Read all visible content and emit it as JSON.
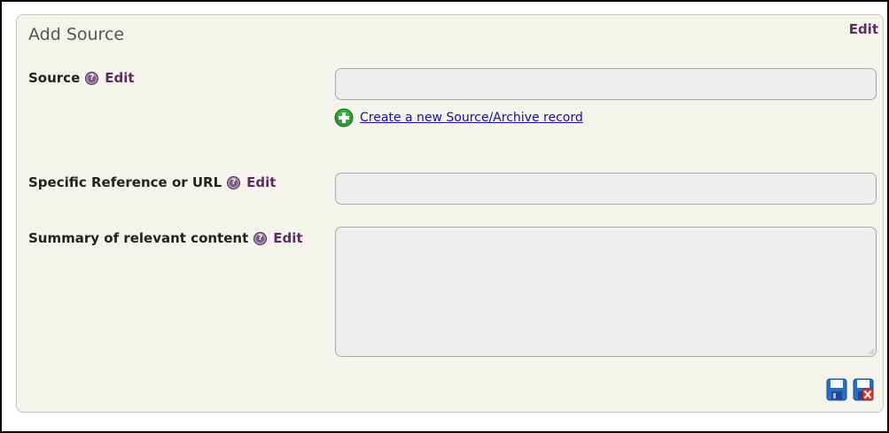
{
  "panel": {
    "title": "Add Source",
    "edit_label": "Edit"
  },
  "fields": {
    "source": {
      "label": "Source",
      "edit_label": "Edit",
      "value": "",
      "create_link": "Create a new Source/Archive record"
    },
    "reference": {
      "label": "Specific Reference or URL",
      "edit_label": "Edit",
      "value": ""
    },
    "summary": {
      "label": "Summary of relevant content",
      "edit_label": "Edit",
      "value": ""
    }
  },
  "icons": {
    "help": "help-icon",
    "create": "plus-circle-icon",
    "save": "floppy-disk-icon",
    "cancel": "floppy-disk-cancel-icon"
  },
  "colors": {
    "panel_background": "#f5f4ec",
    "edit_link": "#5c2d62",
    "create_link": "#1a0dab",
    "plus_icon": "#2e9a2e",
    "save_icon": "#2b6cc4",
    "cancel_badge": "#d8382a"
  }
}
